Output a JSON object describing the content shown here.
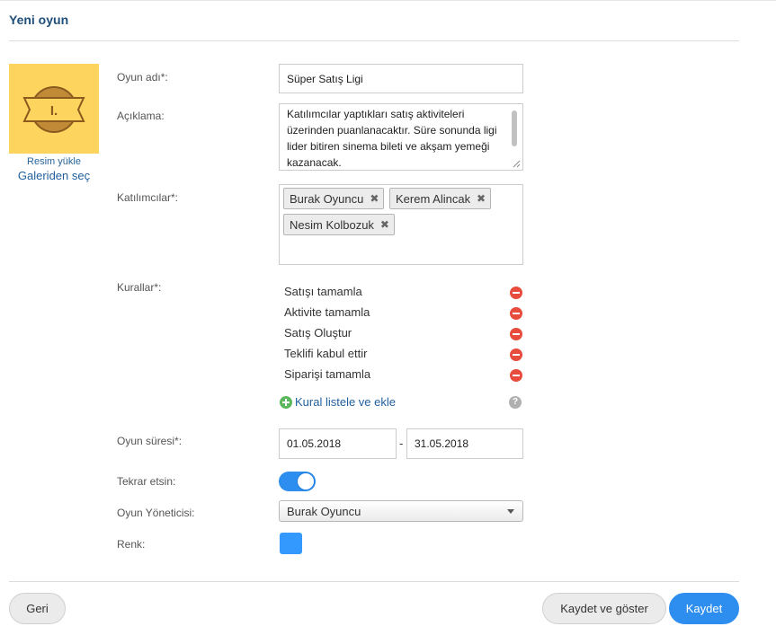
{
  "header": {
    "title": "Yeni oyun"
  },
  "image_panel": {
    "badge_text": "I.",
    "upload_label": "Resim yükle",
    "gallery_label": "Galeriden seç",
    "bg_color": "#fcd45e"
  },
  "form": {
    "game_name": {
      "label": "Oyun adı*:",
      "value": "Süper Satış Ligi"
    },
    "description": {
      "label": "Açıklama:",
      "value": "Katılımcılar yaptıkları satış aktiviteleri üzerinden puanlanacaktır. Süre sonunda ligi lider bitiren sinema bileti ve akşam yemeği kazanacak."
    },
    "participants": {
      "label": "Katılımcılar*:",
      "items": [
        "Burak Oyuncu",
        "Kerem Alincak",
        "Nesim Kolbozuk"
      ]
    },
    "rules": {
      "label": "Kurallar*:",
      "items": [
        "Satışı tamamla",
        "Aktivite tamamla",
        "Satış Oluştur",
        "Teklifi kabul ettir",
        "Siparişi tamamla"
      ],
      "add_label": "Kural listele ve ekle",
      "help_icon": "?"
    },
    "duration": {
      "label": "Oyun süresi*:",
      "start": "01.05.2018",
      "separator": "-",
      "end": "31.05.2018"
    },
    "repeat": {
      "label": "Tekrar etsin:",
      "enabled": true
    },
    "manager": {
      "label": "Oyun Yöneticisi:",
      "selected": "Burak Oyuncu"
    },
    "color": {
      "label": "Renk:",
      "value": "#3399ff"
    }
  },
  "footer": {
    "back_label": "Geri",
    "save_show_label": "Kaydet ve göster",
    "save_label": "Kaydet"
  },
  "colors": {
    "primary": "#2d8ef0",
    "remove": "#e74c3c",
    "add": "#5cb85c",
    "title": "#1f4e79"
  }
}
